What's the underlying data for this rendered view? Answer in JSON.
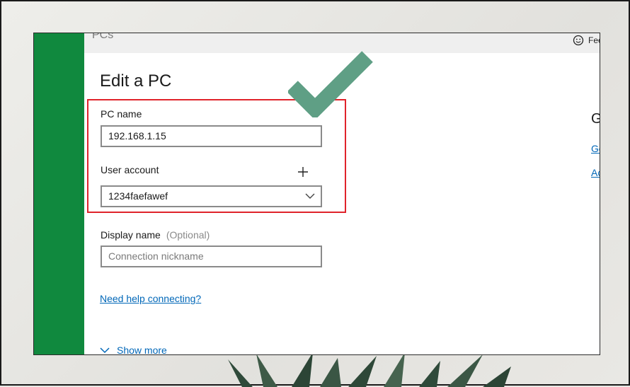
{
  "app": {
    "section_title": "PCs",
    "feedback_label": "Feedback"
  },
  "form": {
    "heading": "Edit a PC",
    "pc_name_label": "PC name",
    "pc_name_value": "192.168.1.15",
    "user_account_label": "User account",
    "user_account_value": "1234faefawef",
    "display_name_label": "Display name",
    "display_name_optional": "(Optional)",
    "display_name_placeholder": "Connection nickname",
    "help_link": "Need help connecting?",
    "show_more": "Show more"
  },
  "right_panel": {
    "heading": "G",
    "link_1": "Ge",
    "link_2": "Ac"
  },
  "colors": {
    "sidebar": "#10893e",
    "accent": "#0067b8",
    "highlight": "#e0232b",
    "checkmark": "#5f9f85"
  },
  "icons": [
    "smiley-icon",
    "plus-icon",
    "chevron-down-icon",
    "checkmark-icon"
  ]
}
